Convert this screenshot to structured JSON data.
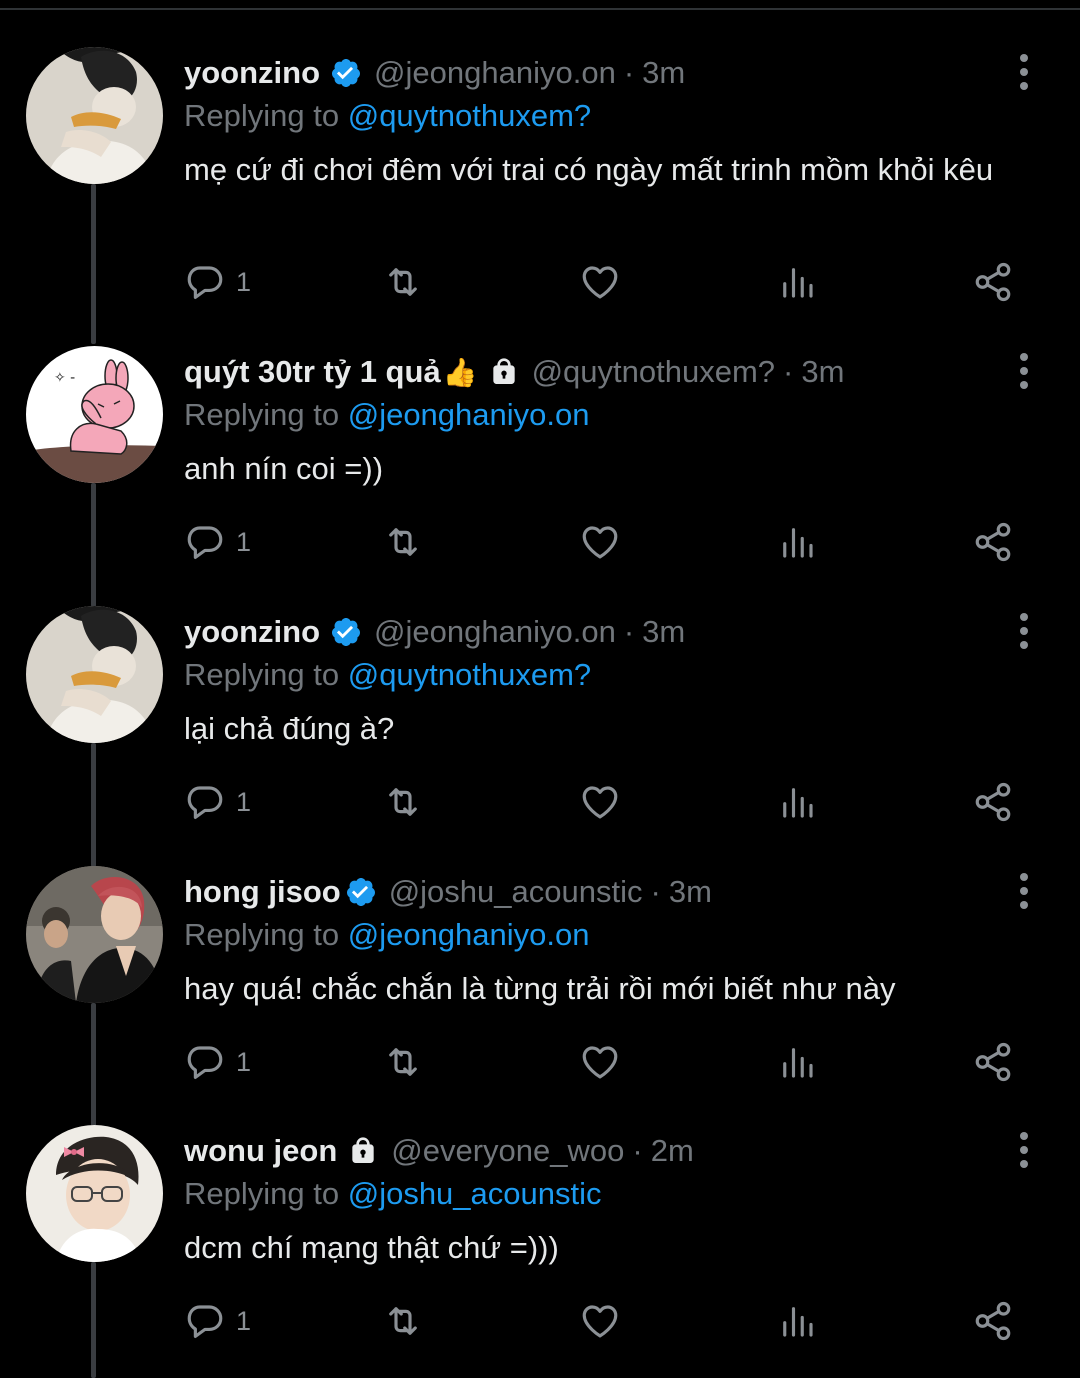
{
  "tweets": [
    {
      "name": "yoonzino",
      "verified": true,
      "locked": false,
      "emoji": "",
      "handle": "@jeonghaniyo.on",
      "dot": "·",
      "time": "3m",
      "replying_prefix": "Replying to ",
      "replying_to": "@quytnothuxem?",
      "text": "mẹ cứ đi chơi đêm với trai có ngày mất trinh mồm khỏi kêu",
      "reply_count": "1",
      "avatar": "photo-eating"
    },
    {
      "name": "quýt 30tr tỷ 1 quả",
      "verified": false,
      "locked": true,
      "emoji": "👍",
      "handle": "@quytnothuxem?",
      "dot": "·",
      "time": "3m",
      "replying_prefix": "Replying to ",
      "replying_to": "@jeonghaniyo.on",
      "text": "anh nín coi =))",
      "reply_count": "1",
      "avatar": "pink-rabbit-cartoon"
    },
    {
      "name": "yoonzino",
      "verified": true,
      "locked": false,
      "emoji": "",
      "handle": "@jeonghaniyo.on",
      "dot": "·",
      "time": "3m",
      "replying_prefix": "Replying to ",
      "replying_to": "@quytnothuxem?",
      "text": "lại chả đúng à?",
      "reply_count": "1",
      "avatar": "photo-eating"
    },
    {
      "name": "hong jisoo",
      "verified": true,
      "locked": false,
      "emoji": "",
      "handle": "@joshu_acounstic",
      "dot": "·",
      "time": "3m",
      "replying_prefix": "Replying to ",
      "replying_to": "@jeonghaniyo.on",
      "text": "hay quá! chắc chắn là từng trải rồi mới biết như này",
      "reply_count": "1",
      "avatar": "photo-red-hair"
    },
    {
      "name": "wonu jeon",
      "verified": false,
      "locked": true,
      "emoji": "",
      "handle": "@everyone_woo",
      "dot": "·",
      "time": "2m",
      "replying_prefix": "Replying to ",
      "replying_to": "@joshu_acounstic",
      "text": "dcm chí mạng thật chứ =)))",
      "reply_count": "1",
      "avatar": "photo-glasses-bow"
    }
  ],
  "icons": {
    "verified": "verified-badge-icon",
    "lock": "lock-icon",
    "reply": "reply-icon",
    "retweet": "retweet-icon",
    "like": "heart-icon",
    "views": "views-chart-icon",
    "share": "share-icon",
    "more": "more-vertical-icon"
  },
  "colors": {
    "background": "#000000",
    "text": "#e7e9ea",
    "muted": "#71767b",
    "link": "#1d9bf0",
    "verified": "#1d9bf0",
    "thread_line": "#3a3d41"
  }
}
